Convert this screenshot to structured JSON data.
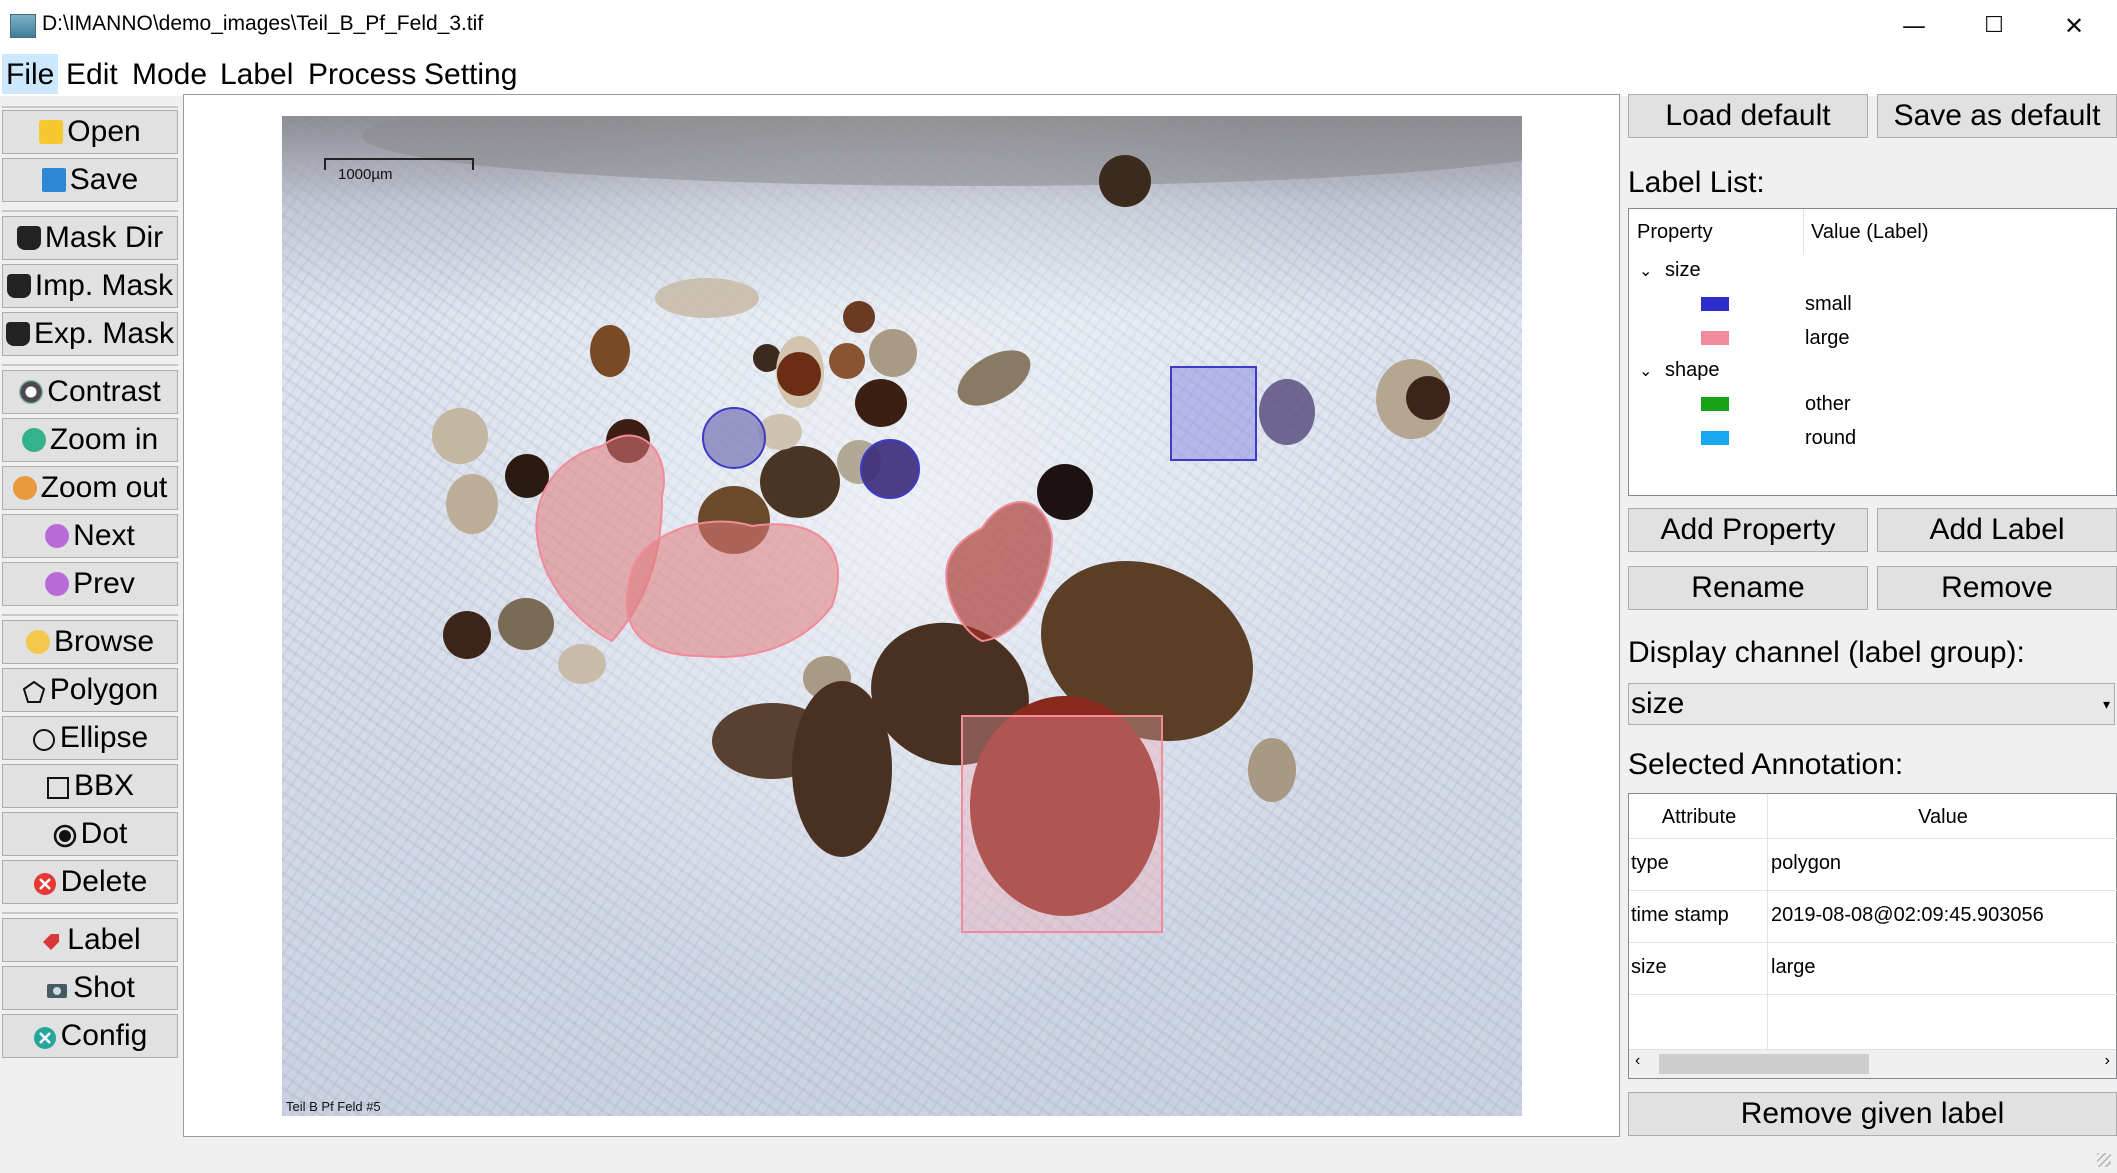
{
  "window": {
    "title": "D:\\IMANNO\\demo_images\\Teil_B_Pf_Feld_3.tif",
    "minimize": "—",
    "maximize": "☐",
    "close": "✕"
  },
  "menu": [
    "File",
    "Edit",
    "Mode",
    "Label",
    "Process",
    "Setting"
  ],
  "toolbar": {
    "open": "Open",
    "save": "Save",
    "mask_dir": "Mask Dir",
    "imp_mask": "Imp. Mask",
    "exp_mask": "Exp. Mask",
    "contrast": "Contrast",
    "zoom_in": "Zoom in",
    "zoom_out": "Zoom out",
    "next": "Next",
    "prev": "Prev",
    "browse": "Browse",
    "polygon": "Polygon",
    "ellipse": "Ellipse",
    "bbx": "BBX",
    "dot": "Dot",
    "delete": "Delete",
    "label": "Label",
    "shot": "Shot",
    "config": "Config"
  },
  "image": {
    "scale_label": "1000µm",
    "footer_label": "Teil B Pf Feld #5"
  },
  "right_panel": {
    "load_default": "Load default",
    "save_as_default": "Save as default",
    "label_list_title": "Label List:",
    "label_list": {
      "col_property": "Property",
      "col_value": "Value (Label)",
      "groups": [
        {
          "name": "size",
          "labels": [
            {
              "name": "small",
              "color": "#2d2dcc"
            },
            {
              "name": "large",
              "color": "#f28a9a"
            }
          ]
        },
        {
          "name": "shape",
          "labels": [
            {
              "name": "other",
              "color": "#17a317"
            },
            {
              "name": "round",
              "color": "#18a8f0"
            }
          ]
        }
      ]
    },
    "add_property": "Add Property",
    "add_label": "Add Label",
    "rename": "Rename",
    "remove": "Remove",
    "display_channel_title": "Display channel (label group):",
    "display_channel_value": "size",
    "selected_annotation_title": "Selected Annotation:",
    "annotation_table": {
      "col_attribute": "Attribute",
      "col_value": "Value",
      "rows": [
        {
          "attribute": "type",
          "value": "polygon"
        },
        {
          "attribute": "time stamp",
          "value": "2019-08-08@02:09:45.903056"
        },
        {
          "attribute": "size",
          "value": "large"
        }
      ]
    },
    "remove_given_label": "Remove given label"
  },
  "colors": {
    "annotation_large": "#f28a9a",
    "annotation_small": "#3b3bc8",
    "button_bg": "#e1e1e1"
  }
}
